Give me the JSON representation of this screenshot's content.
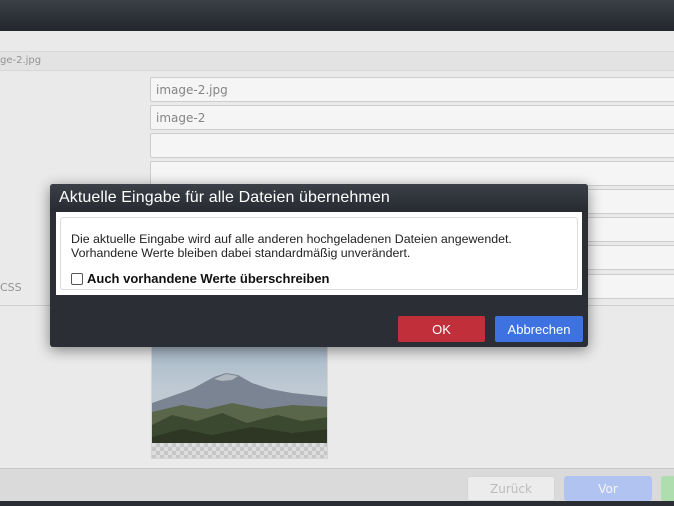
{
  "background": {
    "filename": "ge-2.jpg",
    "fields": [
      {
        "value": "image-2.jpg"
      },
      {
        "value": "image-2"
      },
      {
        "value": ""
      },
      {
        "value": ""
      },
      {
        "value": ""
      },
      {
        "value": ""
      },
      {
        "value": ""
      },
      {
        "value": ""
      }
    ],
    "label_fragment": "CSS",
    "footer": {
      "back_label": "Zurück",
      "next_label": "Vor"
    }
  },
  "modal": {
    "title": "Aktuelle Eingabe für alle Dateien übernehmen",
    "message_line1": "Die aktuelle Eingabe wird auf alle anderen hochgeladenen Dateien angewendet.",
    "message_line2": "Vorhandene Werte bleiben dabei standardmäßig unverändert.",
    "checkbox_label": "Auch vorhandene Werte überschreiben",
    "checkbox_checked": false,
    "ok_label": "OK",
    "cancel_label": "Abbrechen"
  },
  "colors": {
    "ok_button": "#c12f3a",
    "cancel_button": "#3d72e0",
    "titlebar": "#2b2e35"
  }
}
